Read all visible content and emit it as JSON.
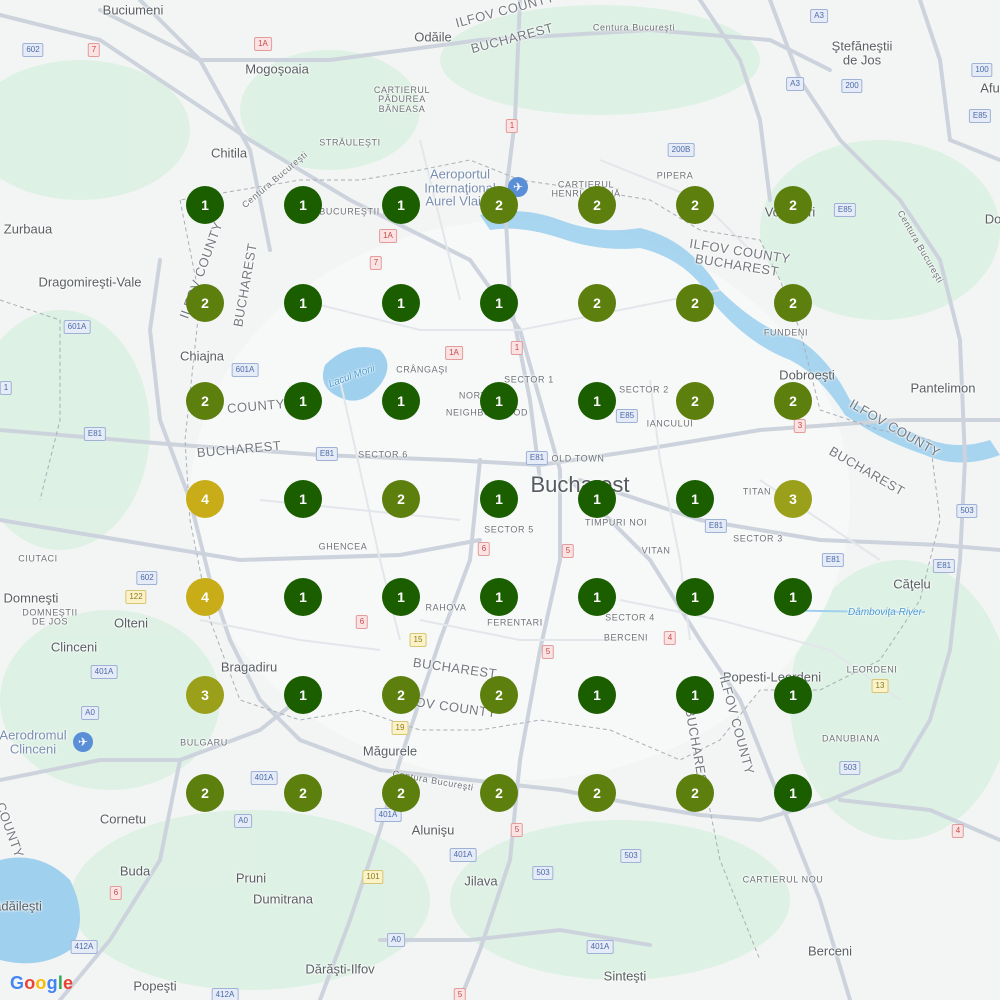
{
  "map": {
    "attribution": "Google",
    "city_label": "Bucharest",
    "place_labels": [
      {
        "id": "buciumeni",
        "text": "Buciumeni",
        "cls": ""
      },
      {
        "id": "odaile",
        "text": "Odăile",
        "cls": ""
      },
      {
        "id": "ilfov-top",
        "text": "ILFOV COUNTY",
        "cls": "admin"
      },
      {
        "id": "bucharest-top",
        "text": "BUCHAREST",
        "cls": "admin"
      },
      {
        "id": "centura-top",
        "text": "Centura Bucureşti",
        "cls": "small"
      },
      {
        "id": "stefanestii",
        "text": "Ştefăneştii\nde Jos",
        "cls": ""
      },
      {
        "id": "afu",
        "text": "Afu",
        "cls": ""
      },
      {
        "id": "mogosoaia",
        "text": "Mogoşoaia",
        "cls": ""
      },
      {
        "id": "cartierul-padurea",
        "text": "CARTIERUL\nPĂDUREA\nBĂNEASA",
        "cls": "small"
      },
      {
        "id": "straulesti",
        "text": "STRĂULEŞTI",
        "cls": "small"
      },
      {
        "id": "chitila",
        "text": "Chitila",
        "cls": ""
      },
      {
        "id": "centura-nw",
        "text": "Centura Bucureşti",
        "cls": "small"
      },
      {
        "id": "aeroport",
        "text": "Aeroportul\nInternaţional\nAurel Vlaicu",
        "cls": "poi"
      },
      {
        "id": "cartierul-henri",
        "text": "CARTIERUL\nHENRI COANĂ",
        "cls": "small"
      },
      {
        "id": "pipera",
        "text": "PIPERA",
        "cls": "small"
      },
      {
        "id": "voluntari",
        "text": "Voluntari",
        "cls": ""
      },
      {
        "id": "do",
        "text": "Do",
        "cls": ""
      },
      {
        "id": "zurbaua",
        "text": "Zurbaua",
        "cls": ""
      },
      {
        "id": "bucurestii",
        "text": "BUCUREŞTII NOI",
        "cls": "small"
      },
      {
        "id": "ilfov-mid",
        "text": "ILFOV COUNTY",
        "cls": "admin"
      },
      {
        "id": "bucharest-mid",
        "text": "BUCHAREST",
        "cls": "admin"
      },
      {
        "id": "centura-e",
        "text": "Centura Bucureşti",
        "cls": "small"
      },
      {
        "id": "dragomiresti",
        "text": "Dragomireşti-Vale",
        "cls": ""
      },
      {
        "id": "ilfov-w",
        "text": "ILFOV COUNTY",
        "cls": "admin"
      },
      {
        "id": "bucharest-w",
        "text": "BUCHAREST",
        "cls": "admin"
      },
      {
        "id": "fundeni",
        "text": "FUNDENI",
        "cls": "small"
      },
      {
        "id": "chiajna",
        "text": "Chiajna",
        "cls": ""
      },
      {
        "id": "lacul-morii",
        "text": "Lacul Morii",
        "cls": "water"
      },
      {
        "id": "crangasi",
        "text": "CRÂNGAŞI",
        "cls": "small"
      },
      {
        "id": "sector1",
        "text": "SECTOR 1",
        "cls": "small"
      },
      {
        "id": "sector2",
        "text": "SECTOR 2",
        "cls": "small"
      },
      {
        "id": "dobroesti",
        "text": "Dobroeşti",
        "cls": ""
      },
      {
        "id": "pantelimon",
        "text": "Pantelimon",
        "cls": ""
      },
      {
        "id": "county-w",
        "text": "COUNTY",
        "cls": "admin"
      },
      {
        "id": "northway",
        "text": "NORTHWAY",
        "cls": "small"
      },
      {
        "id": "neighborhood",
        "text": "NEIGHBORHOOD",
        "cls": "small"
      },
      {
        "id": "iancului",
        "text": "IANCULUI",
        "cls": "small"
      },
      {
        "id": "ilfov-e",
        "text": "ILFOV COUNTY",
        "cls": "admin"
      },
      {
        "id": "bucharest-w2",
        "text": "BUCHAREST",
        "cls": "admin"
      },
      {
        "id": "sector6",
        "text": "SECTOR 6",
        "cls": "small"
      },
      {
        "id": "oldtown",
        "text": "OLD TOWN",
        "cls": "small"
      },
      {
        "id": "bucharest-e",
        "text": "BUCHAREST",
        "cls": "admin"
      },
      {
        "id": "titan",
        "text": "TITAN",
        "cls": "small"
      },
      {
        "id": "sector5",
        "text": "SECTOR 5",
        "cls": "small"
      },
      {
        "id": "timpuri",
        "text": "TIMPURI NOI",
        "cls": "small"
      },
      {
        "id": "sector3",
        "text": "SECTOR 3",
        "cls": "small"
      },
      {
        "id": "ghencea",
        "text": "GHENCEA",
        "cls": "small"
      },
      {
        "id": "vitan",
        "text": "VITAN",
        "cls": "small"
      },
      {
        "id": "ciutaci",
        "text": "CIUTACI",
        "cls": "small"
      },
      {
        "id": "catelu",
        "text": "Căţelu",
        "cls": ""
      },
      {
        "id": "domnesti",
        "text": "Domneşti",
        "cls": ""
      },
      {
        "id": "domnestii-jos",
        "text": "DOMNEŞTII\nDE JOS",
        "cls": "small"
      },
      {
        "id": "rahova",
        "text": "RAHOVA",
        "cls": "small"
      },
      {
        "id": "ferentari",
        "text": "FERENTARI",
        "cls": "small"
      },
      {
        "id": "sector4",
        "text": "SECTOR 4",
        "cls": "small"
      },
      {
        "id": "dambovita",
        "text": "Dâmboviţa River",
        "cls": "water"
      },
      {
        "id": "olteni",
        "text": "Olteni",
        "cls": ""
      },
      {
        "id": "berceni-s",
        "text": "BERCENI",
        "cls": "small"
      },
      {
        "id": "clinceni",
        "text": "Clinceni",
        "cls": ""
      },
      {
        "id": "bragadiru",
        "text": "Bragadiru",
        "cls": ""
      },
      {
        "id": "bucharest-s",
        "text": "BUCHAREST",
        "cls": "admin"
      },
      {
        "id": "popesti",
        "text": "Popesti-Leordeni",
        "cls": ""
      },
      {
        "id": "leordeni",
        "text": "LEORDENI",
        "cls": "small"
      },
      {
        "id": "ilfov-s",
        "text": "ILFOV COUNTY",
        "cls": "admin"
      },
      {
        "id": "ilfov-se",
        "text": "ILFOV COUNTY",
        "cls": "admin"
      },
      {
        "id": "bucharest-se",
        "text": "BUCHAREST",
        "cls": "admin"
      },
      {
        "id": "aerodromul",
        "text": "Aerodromul\nClinceni",
        "cls": "poi"
      },
      {
        "id": "bulgaru",
        "text": "BULGARU",
        "cls": "small"
      },
      {
        "id": "magurele",
        "text": "Măgurele",
        "cls": ""
      },
      {
        "id": "danubiana",
        "text": "DANUBIANA",
        "cls": "small"
      },
      {
        "id": "centura-s",
        "text": "Centura Bucureşti",
        "cls": "small"
      },
      {
        "id": "cornetu",
        "text": "Cornetu",
        "cls": ""
      },
      {
        "id": "alunisu",
        "text": "Alunişu",
        "cls": ""
      },
      {
        "id": "county-sw",
        "text": "COUNTY",
        "cls": "admin"
      },
      {
        "id": "buda",
        "text": "Buda",
        "cls": ""
      },
      {
        "id": "pruni",
        "text": "Pruni",
        "cls": ""
      },
      {
        "id": "jilava",
        "text": "Jilava",
        "cls": ""
      },
      {
        "id": "cartierul-nou",
        "text": "CARTIERUL NOU",
        "cls": "small"
      },
      {
        "id": "dumitrana",
        "text": "Dumitrana",
        "cls": ""
      },
      {
        "id": "vadalesti",
        "text": "ădăileşti",
        "cls": ""
      },
      {
        "id": "berceni",
        "text": "Berceni",
        "cls": ""
      },
      {
        "id": "popesti-s",
        "text": "Popeşti",
        "cls": ""
      },
      {
        "id": "darasti",
        "text": "Dărăşti-Ilfov",
        "cls": ""
      },
      {
        "id": "sintesti",
        "text": "Sinteşti",
        "cls": ""
      }
    ],
    "road_shields": [
      {
        "id": "s602a",
        "text": "602",
        "kind": "blue"
      },
      {
        "id": "s7a",
        "text": "7",
        "kind": "red"
      },
      {
        "id": "s1a-top",
        "text": "1A",
        "kind": "red"
      },
      {
        "id": "sa3",
        "text": "A3",
        "kind": "blue"
      },
      {
        "id": "sa3b",
        "text": "A3",
        "kind": "blue"
      },
      {
        "id": "s100",
        "text": "100",
        "kind": "blue"
      },
      {
        "id": "s200",
        "text": "200",
        "kind": "blue"
      },
      {
        "id": "s1-top",
        "text": "1",
        "kind": "red"
      },
      {
        "id": "s200b",
        "text": "200B",
        "kind": "blue"
      },
      {
        "id": "se85a",
        "text": "E85",
        "kind": "blue"
      },
      {
        "id": "se85b",
        "text": "E85",
        "kind": "blue"
      },
      {
        "id": "s1a-mid",
        "text": "1A",
        "kind": "red"
      },
      {
        "id": "s7b",
        "text": "7",
        "kind": "red"
      },
      {
        "id": "s601a",
        "text": "601A",
        "kind": "blue"
      },
      {
        "id": "s1a-c",
        "text": "1A",
        "kind": "red"
      },
      {
        "id": "s1-c",
        "text": "1",
        "kind": "red"
      },
      {
        "id": "s601a-b",
        "text": "601A",
        "kind": "blue"
      },
      {
        "id": "se85c",
        "text": "E85",
        "kind": "blue"
      },
      {
        "id": "s1-w",
        "text": "1",
        "kind": "blue"
      },
      {
        "id": "se81a",
        "text": "E81",
        "kind": "blue"
      },
      {
        "id": "se81b",
        "text": "E81",
        "kind": "blue"
      },
      {
        "id": "se81c",
        "text": "E81",
        "kind": "blue"
      },
      {
        "id": "s6a",
        "text": "6",
        "kind": "red"
      },
      {
        "id": "s5a",
        "text": "5",
        "kind": "red"
      },
      {
        "id": "se81d",
        "text": "E81",
        "kind": "blue"
      },
      {
        "id": "se81e",
        "text": "E81",
        "kind": "blue"
      },
      {
        "id": "s503",
        "text": "503",
        "kind": "blue"
      },
      {
        "id": "se81f",
        "text": "E81",
        "kind": "blue"
      },
      {
        "id": "s3",
        "text": "3",
        "kind": "red"
      },
      {
        "id": "s602b",
        "text": "602",
        "kind": "blue"
      },
      {
        "id": "s122",
        "text": "122",
        "kind": "yellow"
      },
      {
        "id": "s6b",
        "text": "6",
        "kind": "red"
      },
      {
        "id": "s15",
        "text": "15",
        "kind": "yellow"
      },
      {
        "id": "s4a",
        "text": "4",
        "kind": "red"
      },
      {
        "id": "s5b",
        "text": "5",
        "kind": "red"
      },
      {
        "id": "s401a",
        "text": "401A",
        "kind": "blue"
      },
      {
        "id": "sa0a",
        "text": "A0",
        "kind": "blue"
      },
      {
        "id": "s19",
        "text": "19",
        "kind": "yellow"
      },
      {
        "id": "s13",
        "text": "13",
        "kind": "yellow"
      },
      {
        "id": "s503b",
        "text": "503",
        "kind": "blue"
      },
      {
        "id": "s401a-b",
        "text": "401A",
        "kind": "blue"
      },
      {
        "id": "s401a-c",
        "text": "401A",
        "kind": "blue"
      },
      {
        "id": "sa0b",
        "text": "A0",
        "kind": "blue"
      },
      {
        "id": "s5c",
        "text": "5",
        "kind": "red"
      },
      {
        "id": "s4b",
        "text": "4",
        "kind": "red"
      },
      {
        "id": "s401a-d",
        "text": "401A",
        "kind": "blue"
      },
      {
        "id": "s503c",
        "text": "503",
        "kind": "blue"
      },
      {
        "id": "s503d",
        "text": "503",
        "kind": "blue"
      },
      {
        "id": "s101",
        "text": "101",
        "kind": "yellow"
      },
      {
        "id": "s6c",
        "text": "6",
        "kind": "red"
      },
      {
        "id": "sa0c",
        "text": "A0",
        "kind": "blue"
      },
      {
        "id": "s412a",
        "text": "412A",
        "kind": "blue"
      },
      {
        "id": "s412a-b",
        "text": "412A",
        "kind": "blue"
      },
      {
        "id": "s401a-e",
        "text": "401A",
        "kind": "blue"
      },
      {
        "id": "s5d",
        "text": "5",
        "kind": "red"
      }
    ],
    "marker_colors": {
      "1": "#1a5e00",
      "2": "#5c7f0e",
      "3": "#9aa01a",
      "4": "#c8ad18"
    },
    "cluster_grid": [
      [
        1,
        1,
        1,
        2,
        2,
        2,
        2
      ],
      [
        2,
        1,
        1,
        1,
        2,
        2,
        2
      ],
      [
        2,
        1,
        1,
        1,
        1,
        2,
        2
      ],
      [
        4,
        1,
        2,
        1,
        1,
        1,
        3
      ],
      [
        4,
        1,
        1,
        1,
        1,
        1,
        1
      ],
      [
        3,
        1,
        2,
        2,
        1,
        1,
        1
      ],
      [
        2,
        2,
        2,
        2,
        2,
        2,
        1
      ]
    ]
  }
}
